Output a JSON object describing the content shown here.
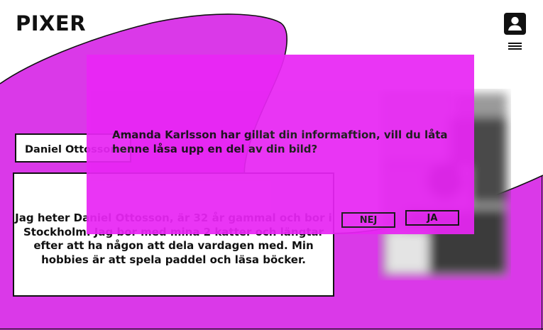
{
  "header": {
    "logo": "PIXER",
    "profile_icon": "user-icon",
    "menu_icon": "hamburger-icon"
  },
  "profile": {
    "name": "Daniel Ottosson",
    "bio": "Jag heter Daniel Ottosson, är 32 år gammal och bor i Stockholm. Jag bor med mina 2 katter och längtar efter att ha någon att dela vardagen med. Min hobbies är att spela paddel och läsa böcker."
  },
  "modal": {
    "message": "Amanda Karlsson har gillat din informaftion, vill du låta henne låsa upp en del av din bild?",
    "no_label": "NEJ",
    "yes_label": "JA"
  },
  "colors": {
    "accent": "#da39e8",
    "overlay": "#e826f4",
    "text": "#111111",
    "background": "#ffffff"
  }
}
